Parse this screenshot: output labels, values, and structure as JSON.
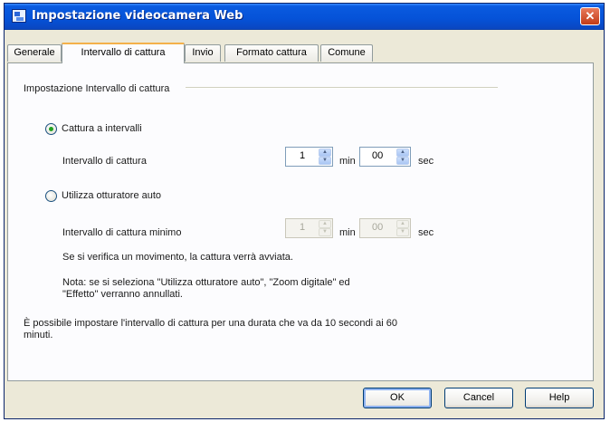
{
  "window": {
    "title": "Impostazione videocamera Web",
    "close_glyph": "✕",
    "icon": "webcam-settings-icon"
  },
  "tabs": [
    {
      "label": "Generale",
      "active": false
    },
    {
      "label": "Intervallo di cattura",
      "active": true
    },
    {
      "label": "Invio",
      "active": false
    },
    {
      "label": "Formato cattura",
      "active": false
    },
    {
      "label": "Comune",
      "active": false
    }
  ],
  "panel": {
    "section_title": "Impostazione Intervallo di cattura",
    "option_interval": {
      "label": "Cattura a intervalli",
      "selected": true,
      "field_label": "Intervallo di cattura",
      "min_value": "1",
      "min_unit": "min",
      "sec_value": "00",
      "sec_unit": "sec"
    },
    "option_auto": {
      "label": "Utilizza otturatore auto",
      "selected": false,
      "field_label": "Intervallo di cattura minimo",
      "min_value": "1",
      "min_unit": "min",
      "sec_value": "00",
      "sec_unit": "sec",
      "motion_note": "Se si verifica un movimento, la cattura verrà avviata.",
      "note": "Nota: se si seleziona \"Utilizza otturatore auto\", \"Zoom digitale\" ed \"Effetto\" verranno annullati."
    },
    "range_note": "È possibile impostare l'intervallo di cattura per una durata che va da 10 secondi ai 60 minuti."
  },
  "buttons": {
    "ok": "OK",
    "cancel": "Cancel",
    "help": "Help"
  },
  "colors": {
    "titlebar": "#0552d8",
    "dialog_bg": "#ece9d8",
    "active_tab_accent": "#f4b14a",
    "close_button": "#c33b16"
  }
}
